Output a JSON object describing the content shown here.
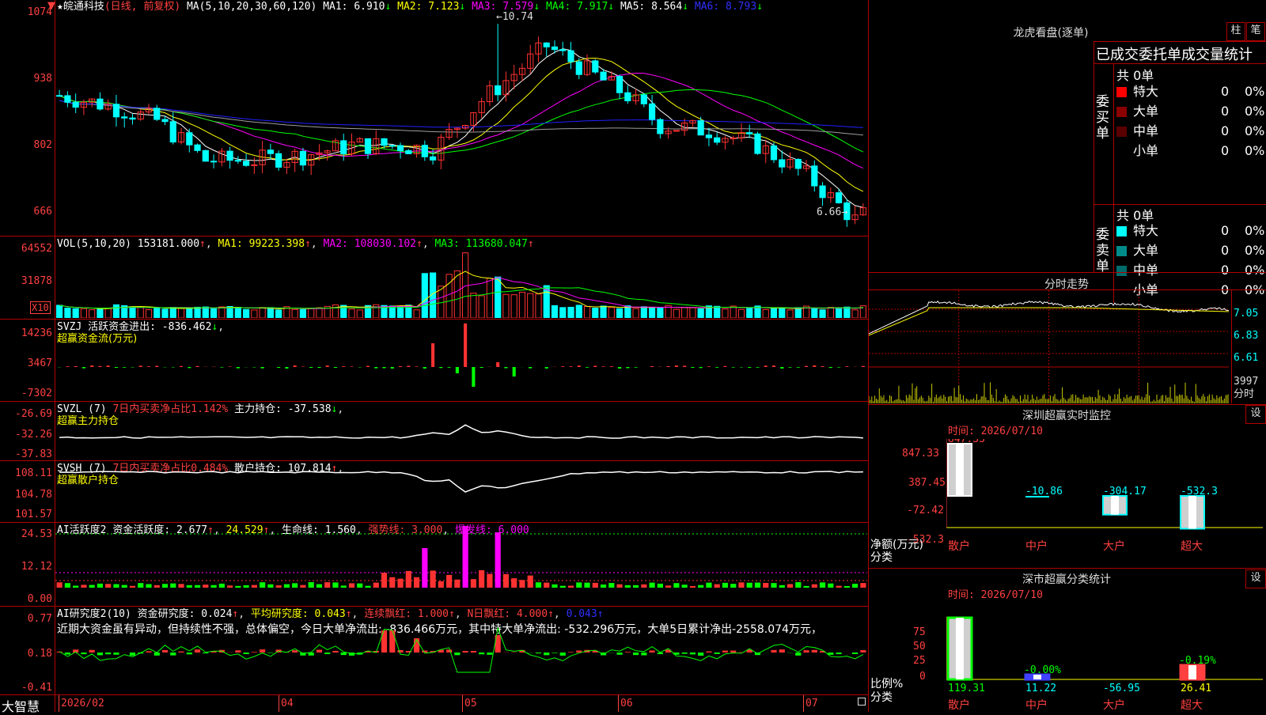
{
  "colors": {
    "up": "#ff3232",
    "down": "#00ffff",
    "grid": "#b00000",
    "ma1": "#ffffff",
    "ma2": "#ffff00",
    "ma3": "#ff00ff",
    "ma4": "#00ff00",
    "ma5": "#9e9e9e",
    "ma6": "#2020ff",
    "green": "#00ff00"
  },
  "header": {
    "star": "★",
    "stock": "皖通科技",
    "mode": "(日线, 前复权)",
    "ma_params": "MA(5,10,20,30,60,120)",
    "ma": [
      {
        "label": "MA1:",
        "value": "6.910",
        "arrow": "↓"
      },
      {
        "label": "MA2:",
        "value": "7.123",
        "arrow": "↓"
      },
      {
        "label": "MA3:",
        "value": "7.579",
        "arrow": "↓"
      },
      {
        "label": "MA4:",
        "value": "7.917",
        "arrow": "↓"
      },
      {
        "label": "MA5:",
        "value": "8.564",
        "arrow": "↓"
      },
      {
        "label": "MA6:",
        "value": "8.793",
        "arrow": "↓"
      }
    ]
  },
  "price_axis": [
    "1074",
    "938",
    "802",
    "666"
  ],
  "price_marks": {
    "high": "10.74",
    "low": "6.66"
  },
  "vol": {
    "title": "VOL(5,10,20)",
    "value": "153181.000",
    "ma1": "MA1: 99223.398",
    "ma2": "MA2: 108030.102",
    "ma3": "MA3: 113680.047",
    "axis": [
      "64552",
      "31878"
    ],
    "unit": "X10"
  },
  "svzj": {
    "title": "SVZJ",
    "desc": "活跃资金进出: -836.462",
    "sub": "超赢资金流(万元)",
    "axis": [
      "14236",
      "3467",
      "-7302"
    ]
  },
  "svzl": {
    "title": "SVZL (7)",
    "desc1": "7日内买卖净占比1.142%",
    "desc2": "主力持仓: -37.538",
    "sub": "超赢主力持仓",
    "axis": [
      "-26.69",
      "-32.26",
      "-37.83"
    ]
  },
  "svsh": {
    "title": "SVSH (7)",
    "desc1": "7日内买卖净占比0.484%",
    "desc2": "散户持仓: 107.814",
    "sub": "超赢散户持仓",
    "axis": [
      "108.11",
      "104.78",
      "101.57"
    ]
  },
  "aihy": {
    "title": "AI活跃度2",
    "desc": "资金活跃度: 2.677",
    "v2": "24.529",
    "life": "生命线: 1.560",
    "strong": "强势线: 3.000",
    "burst": "爆发线: 6.000",
    "axis": [
      "24.53",
      "12.12",
      "0.00"
    ]
  },
  "aiyj": {
    "title": "AI研究度2(10)",
    "desc": "资金研究度: 0.024",
    "avg": "平均研究度: 0.043",
    "lian": "连续飘红: 1.000",
    "nri": "N日飘红: 4.000",
    "last": "0.043",
    "axis": [
      "0.77",
      "0.18",
      "-0.41"
    ],
    "comment": "近期大资金虽有异动，但持续性不强，总体偏空，今日大单净流出: -836.466万元，其中特大单净流出: -532.296万元，大单5日累计净出-2558.074万元，"
  },
  "dates": [
    "2026/02",
    "04",
    "05",
    "06",
    "07"
  ],
  "brand": "大智慧",
  "longhu": {
    "title": "龙虎看盘(逐单)",
    "btn1": "柱",
    "btn2": "笔",
    "header": "已成交委托单成交量统计",
    "buy": {
      "side": "委买单",
      "total": "共 0单",
      "rows": [
        {
          "label": "特大",
          "vol": "0",
          "pct": "0%",
          "color": "#ff0000"
        },
        {
          "label": "大单",
          "vol": "0",
          "pct": "0%",
          "color": "#8b0000"
        },
        {
          "label": "中单",
          "vol": "0",
          "pct": "0%",
          "color": "#5a0000"
        },
        {
          "label": "小单",
          "vol": "0",
          "pct": "0%",
          "color": "#000000"
        }
      ]
    },
    "sell": {
      "side": "委卖单",
      "total": "共 0单",
      "rows": [
        {
          "label": "特大",
          "vol": "0",
          "pct": "0%",
          "color": "#00ffff"
        },
        {
          "label": "大单",
          "vol": "0",
          "pct": "0%",
          "color": "#008b8b"
        },
        {
          "label": "中单",
          "vol": "0",
          "pct": "0%",
          "color": "#006b6b"
        },
        {
          "label": "小单",
          "vol": "0",
          "pct": "0%",
          "color": "#000000"
        }
      ]
    }
  },
  "fenshi": {
    "title": "分时走势",
    "axis": [
      "7.05",
      "6.83",
      "6.61"
    ],
    "vol_axis": "3997",
    "vol_unit": "分时"
  },
  "monitor": {
    "title": "深圳超赢实时监控",
    "btn": "设",
    "time": "时间: 2026/07/10",
    "axis": [
      "847.33",
      "387.45",
      "-72.42",
      "-532.3"
    ],
    "ylabel": "净额(万元)",
    "xlabel": "分类",
    "cats": [
      "散户",
      "中户",
      "大户",
      "超大"
    ],
    "values": [
      847.33,
      -10.86,
      -304.17,
      -532.3
    ],
    "labels": [
      "847.33",
      "-10.86",
      "-304.17",
      "-532.3"
    ]
  },
  "classify": {
    "title": "深市超赢分类统计",
    "btn": "设",
    "time": "时间: 2026/07/10",
    "axis": [
      "75",
      "50",
      "25",
      "0"
    ],
    "ylabel": "比例%",
    "xlabel": "分类",
    "cats": [
      "散户",
      "中户",
      "大户",
      "超大"
    ],
    "bottom": [
      "119.31",
      "11.22",
      "-56.95",
      "26.41"
    ],
    "top": [
      "",
      "-0.00%",
      "",
      "-0.19%"
    ]
  },
  "chart_data": {
    "type": "candlestick",
    "title": "皖通科技 (日线, 前复权)",
    "ohlc": []
  }
}
